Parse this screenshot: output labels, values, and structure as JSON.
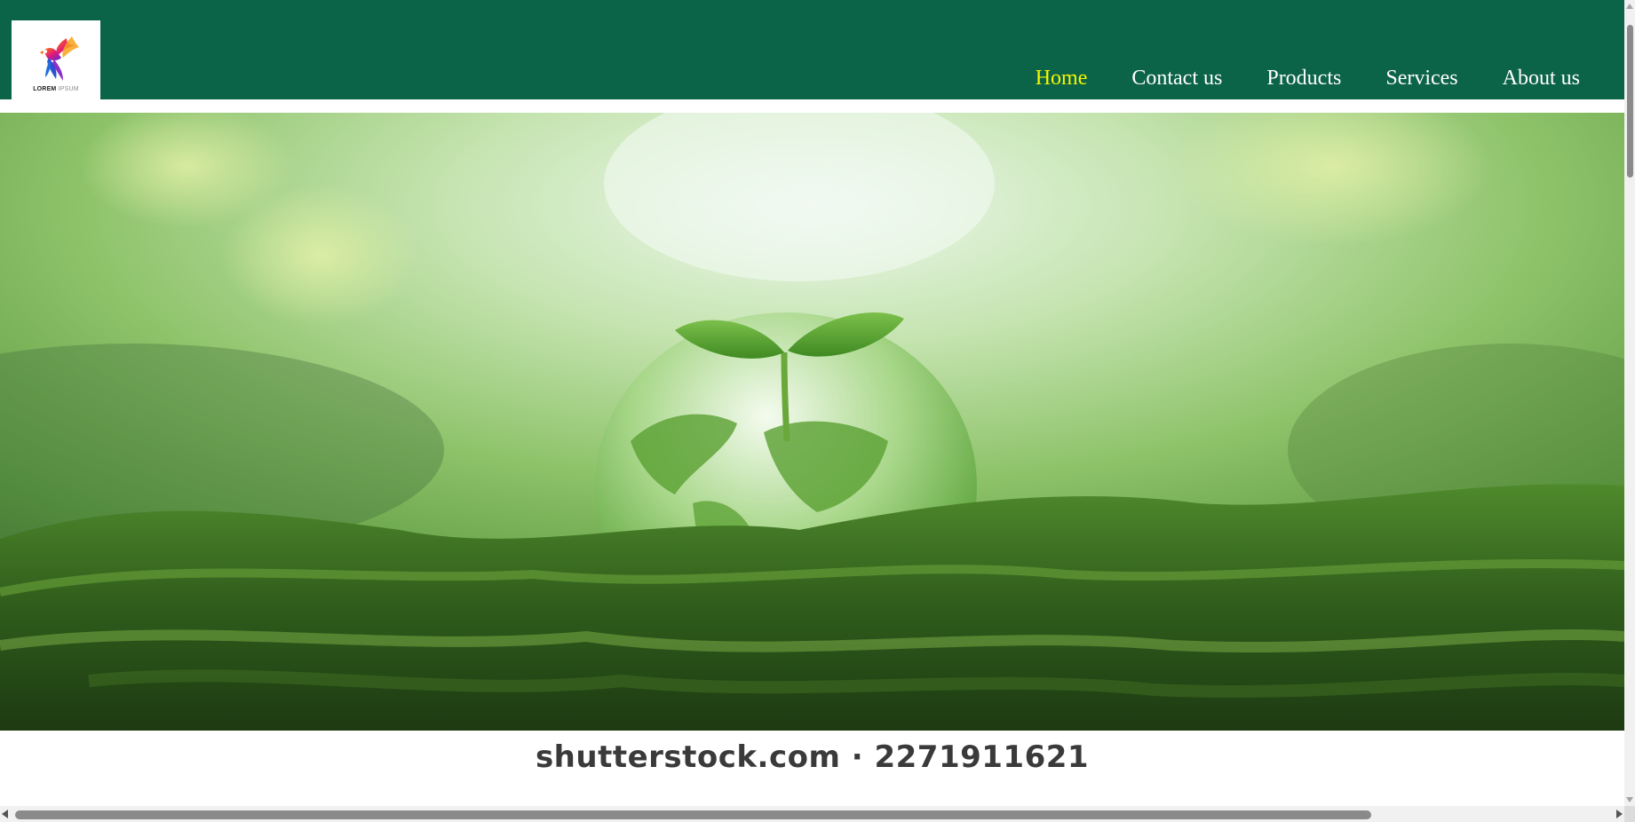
{
  "header": {
    "background_color": "#0c6448",
    "logo": {
      "text_bold": "LOREM",
      "text_light": "IPSUM"
    },
    "nav": {
      "active_color": "#f5f500",
      "items": [
        {
          "label": "Home",
          "active": true
        },
        {
          "label": "Contact us",
          "active": false
        },
        {
          "label": "Products",
          "active": false
        },
        {
          "label": "Services",
          "active": false
        },
        {
          "label": "About us",
          "active": false
        }
      ]
    }
  },
  "hero": {
    "image": "green-globe-sprout-on-moss",
    "caption": "shutterstock.com · 2271911621"
  },
  "scrollbars": {
    "vertical": true,
    "horizontal": true
  }
}
